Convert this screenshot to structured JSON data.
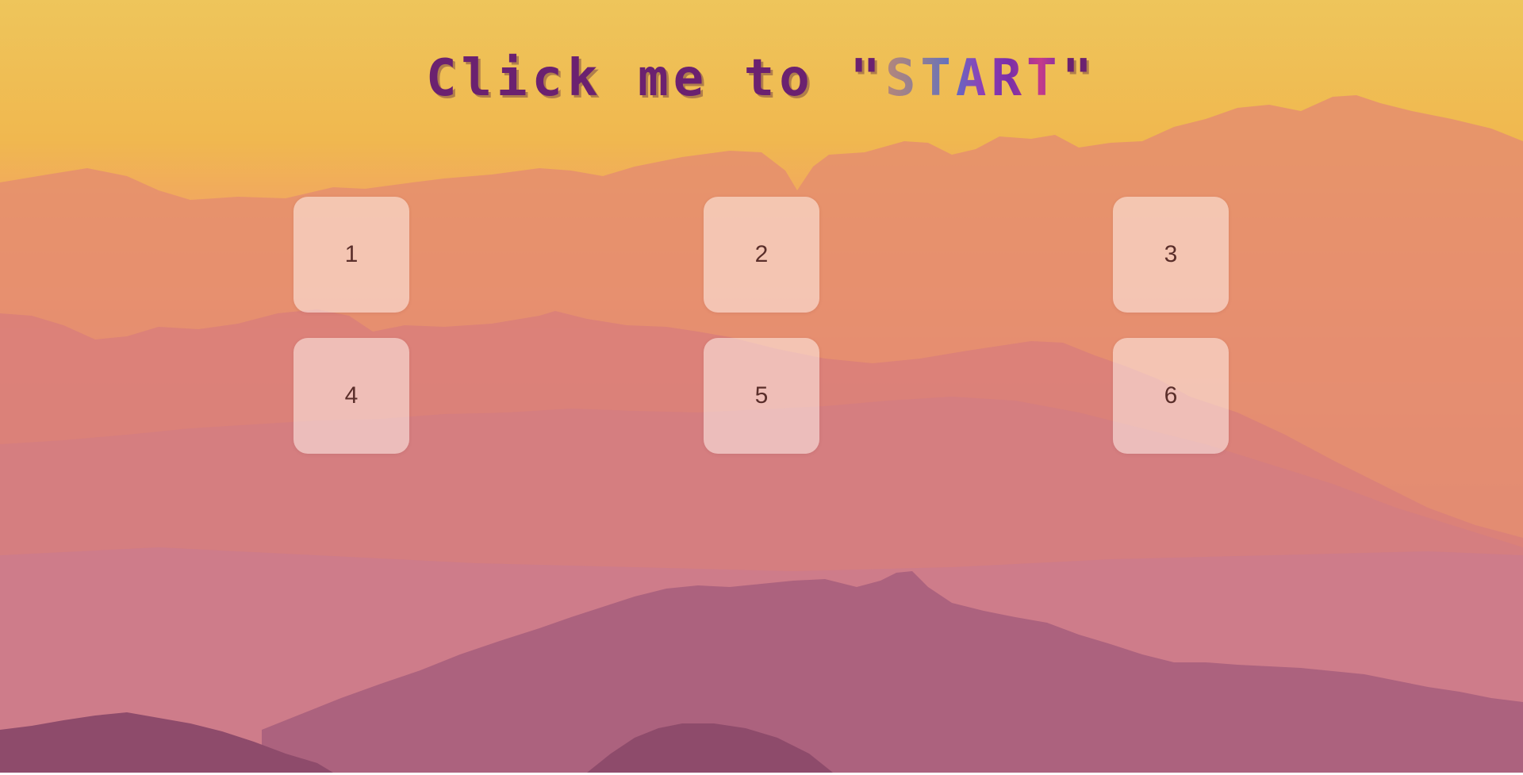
{
  "title": {
    "prefix": "Click me to \"",
    "highlight": "START",
    "suffix": "\""
  },
  "tiles": [
    {
      "label": "1"
    },
    {
      "label": "2"
    },
    {
      "label": "3"
    },
    {
      "label": "4"
    },
    {
      "label": "5"
    },
    {
      "label": "6"
    }
  ],
  "background": {
    "description_icon": "mountain-landscape",
    "colors": {
      "sky_top": "#eec55b",
      "sky_mid": "#f0b84f",
      "haze": "#f2a166",
      "mountain_far": "#e0866e",
      "mountain_mid": "#d37a7e",
      "mountain_near": "#a85b78",
      "mountain_front": "#8e4a6a"
    }
  }
}
